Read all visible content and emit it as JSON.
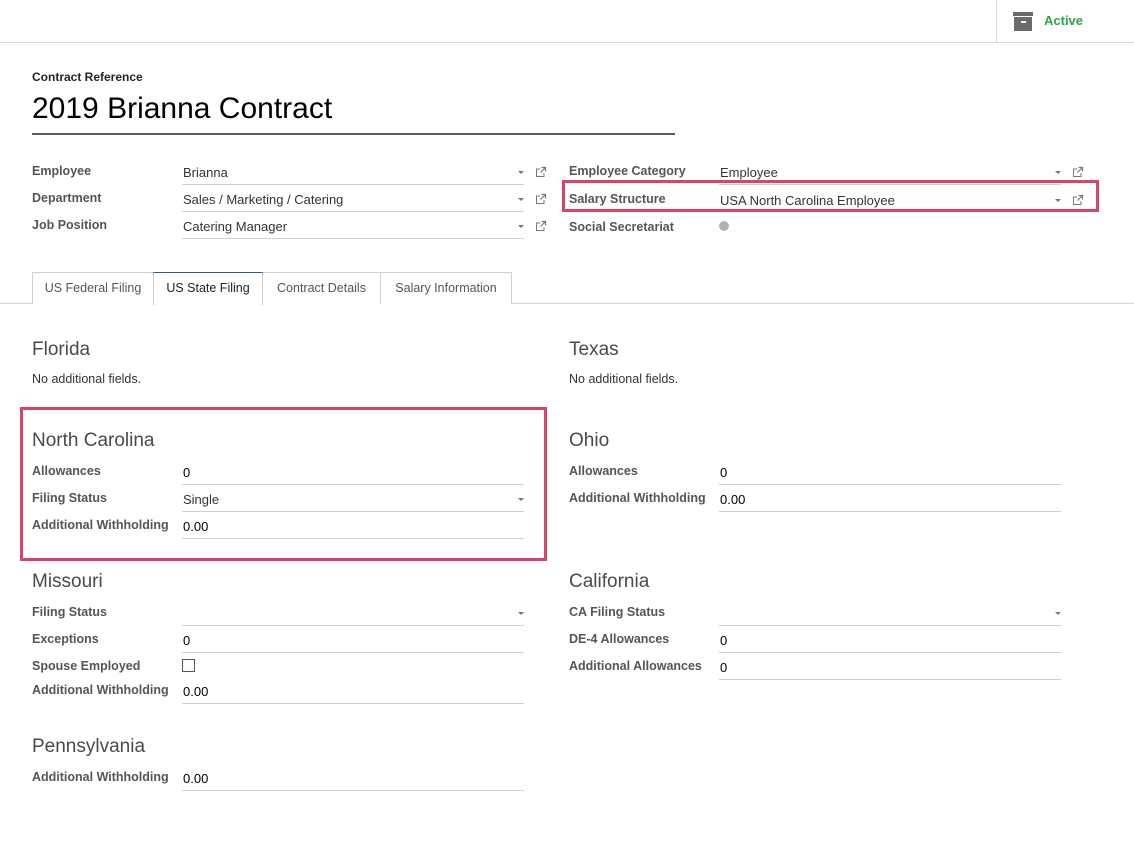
{
  "status": {
    "active_label": "Active",
    "active_color": "#28a745",
    "icon": "archive-icon"
  },
  "contract": {
    "reference_label": "Contract Reference",
    "reference_value": "2019 Brianna Contract"
  },
  "left_fields": [
    {
      "label": "Employee",
      "value": "Brianna"
    },
    {
      "label": "Department",
      "value": "Sales / Marketing / Catering"
    },
    {
      "label": "Job Position",
      "value": "Catering Manager"
    }
  ],
  "right_fields": [
    {
      "label": "Employee Category",
      "value": "Employee"
    },
    {
      "label": "Salary Structure",
      "value": "USA North Carolina Employee"
    },
    {
      "label": "Social Secretariat",
      "value": ""
    }
  ],
  "highlight_color": "#d9436a",
  "tabs": [
    {
      "label": "US Federal Filing",
      "active": false
    },
    {
      "label": "US State Filing",
      "active": true
    },
    {
      "label": "Contract Details",
      "active": false
    },
    {
      "label": "Salary Information",
      "active": false
    }
  ],
  "states": {
    "florida": {
      "title": "Florida",
      "note": "No additional fields."
    },
    "texas": {
      "title": "Texas",
      "note": "No additional fields."
    },
    "north_carolina": {
      "title": "North Carolina",
      "fields": [
        {
          "label": "Allowances",
          "value": "0"
        },
        {
          "label": "Filing Status",
          "value": "Single"
        },
        {
          "label": "Additional Withholding",
          "value": "0.00"
        }
      ]
    },
    "ohio": {
      "title": "Ohio",
      "fields": [
        {
          "label": "Allowances",
          "value": "0"
        },
        {
          "label": "Additional Withholding",
          "value": "0.00"
        }
      ]
    },
    "missouri": {
      "title": "Missouri",
      "fields": [
        {
          "label": "Filing Status",
          "value": ""
        },
        {
          "label": "Exceptions",
          "value": "0"
        },
        {
          "label": "Spouse Employed",
          "checked": false
        },
        {
          "label": "Additional Withholding",
          "value": "0.00"
        }
      ]
    },
    "california": {
      "title": "California",
      "fields": [
        {
          "label": "CA Filing Status",
          "value": ""
        },
        {
          "label": "DE-4 Allowances",
          "value": "0"
        },
        {
          "label": "Additional Allowances",
          "value": "0"
        }
      ]
    },
    "pennsylvania": {
      "title": "Pennsylvania",
      "fields": [
        {
          "label": "Additional Withholding",
          "value": "0.00"
        }
      ]
    }
  }
}
